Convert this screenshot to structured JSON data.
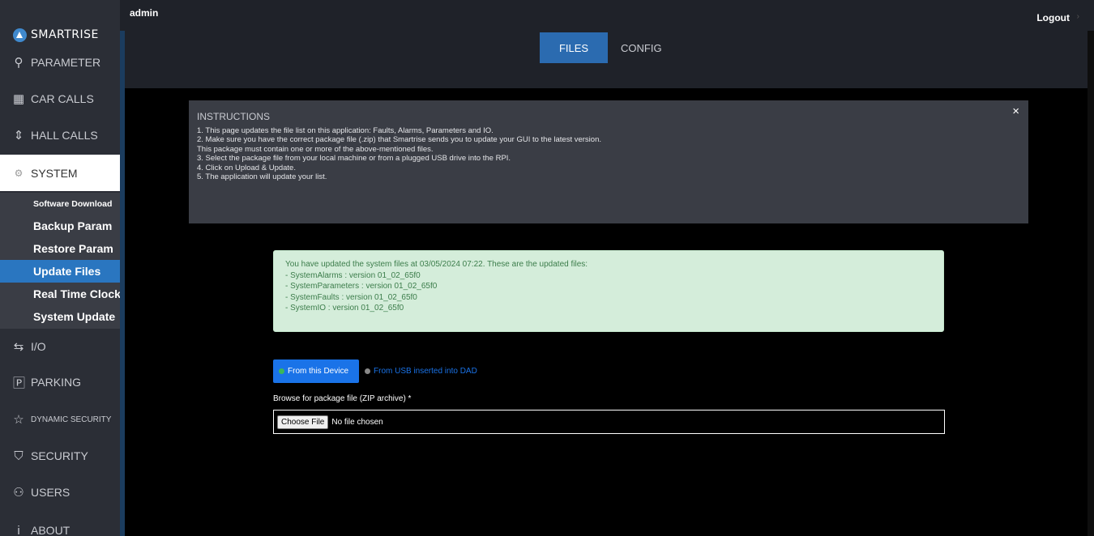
{
  "header": {
    "user": "admin",
    "logout_label": "Logout"
  },
  "brand": {
    "logo_text": "SMARTRISE"
  },
  "sidebar": {
    "items": [
      {
        "label": "PARAMETER",
        "icon": "parameter-icon",
        "glyph": "⚲"
      },
      {
        "label": "CAR CALLS",
        "icon": "car-calls-icon",
        "glyph": "▦"
      },
      {
        "label": "HALL CALLS",
        "icon": "hall-calls-icon",
        "glyph": "⇕"
      },
      {
        "label": "SYSTEM",
        "icon": "gear-icon",
        "glyph": "⚙"
      },
      {
        "label": "I/O",
        "icon": "io-icon",
        "glyph": "⇆"
      },
      {
        "label": "PARKING",
        "icon": "parking-icon",
        "glyph": "🄿"
      },
      {
        "label": "DYNAMIC SECURITY",
        "icon": "star-icon",
        "glyph": "☆"
      },
      {
        "label": "SECURITY",
        "icon": "shield-icon",
        "glyph": "⛉"
      },
      {
        "label": "USERS",
        "icon": "users-icon",
        "glyph": "⚇"
      },
      {
        "label": "ABOUT",
        "icon": "info-icon",
        "glyph": "i"
      }
    ],
    "system_submenu": [
      "Software Download",
      "Backup Param",
      "Restore Param",
      "Update Files",
      "Real Time Clock",
      "System Update"
    ]
  },
  "tabs": {
    "files": "FILES",
    "config": "CONFIG"
  },
  "instructions": {
    "title": "INSTRUCTIONS",
    "close": "×",
    "lines": [
      "1. This page updates the file list on this application: Faults, Alarms, Parameters and IO.",
      "2. Make sure you have the correct package file (.zip) that Smartrise sends you to update your GUI to the latest version.",
      "This package must contain one or more of the above-mentioned files.",
      "3. Select the package file from your local machine or from a plugged USB drive into the RPI.",
      "4. Click on Upload & Update.",
      "5. The application will update your list."
    ]
  },
  "alert": {
    "lines": [
      "You have updated the system files at 03/05/2024 07:22. These are the updated files:",
      "- SystemAlarms : version 01_02_65f0",
      "- SystemParameters : version 01_02_65f0",
      "- SystemFaults : version 01_02_65f0",
      "- SystemIO : version 01_02_65f0"
    ]
  },
  "source": {
    "device_label": "From this Device",
    "usb_label": "From USB inserted into DAD"
  },
  "upload": {
    "browse_label": "Browse for package file (ZIP archive) *",
    "choose_button": "Choose File",
    "no_file": "No file chosen"
  }
}
